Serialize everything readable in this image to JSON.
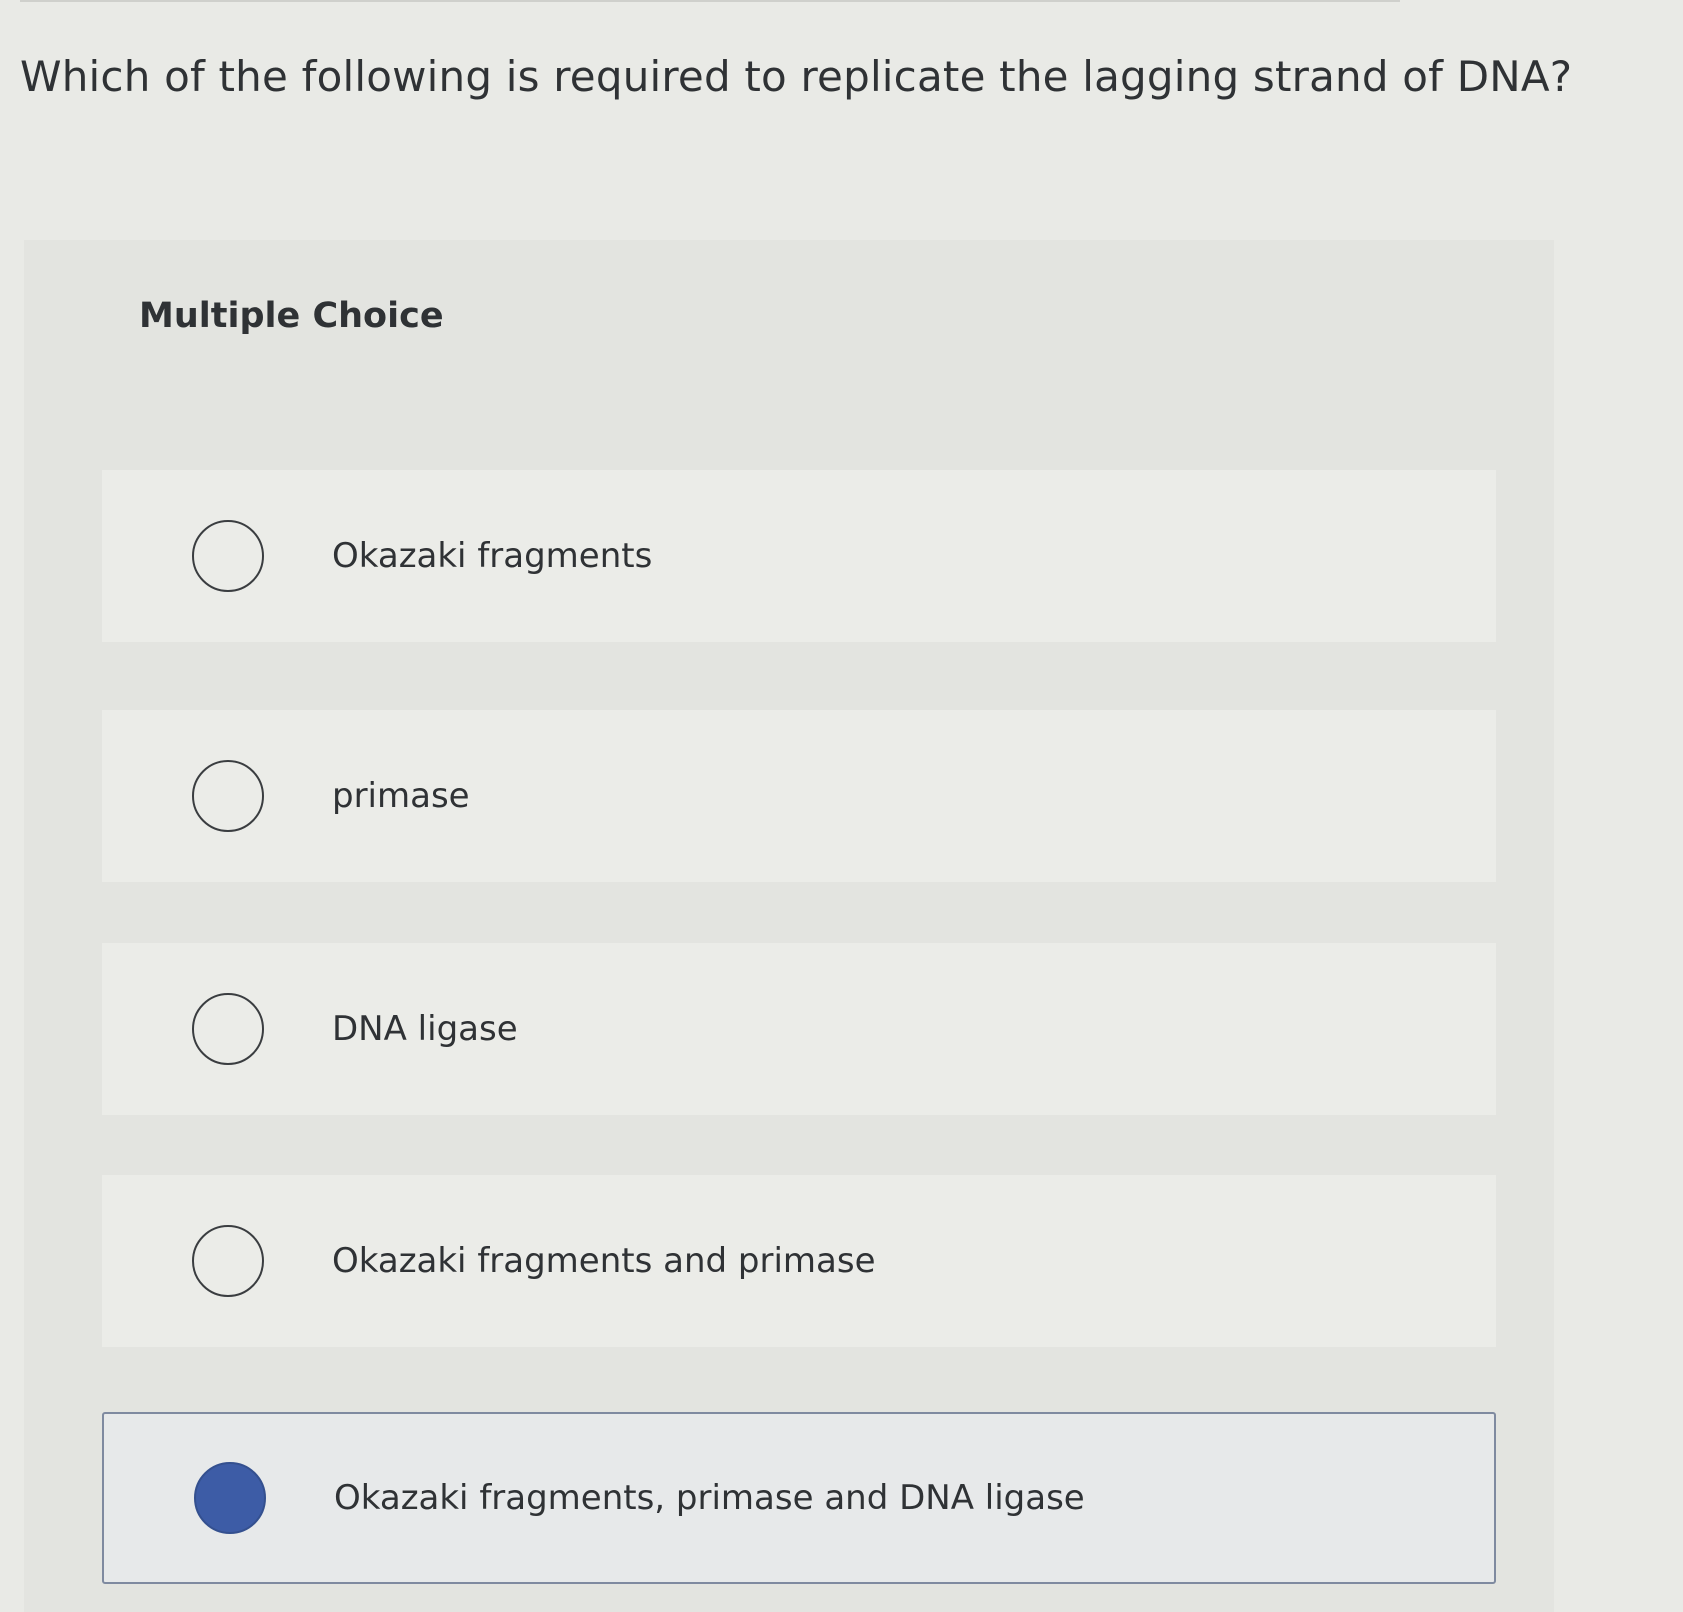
{
  "question": "Which of the following is required to replicate the lagging strand of DNA?",
  "section_label": "Multiple Choice",
  "options": [
    {
      "label": "Okazaki fragments",
      "selected": false
    },
    {
      "label": "primase",
      "selected": false
    },
    {
      "label": "DNA ligase",
      "selected": false
    },
    {
      "label": "Okazaki fragments and primase",
      "selected": false
    },
    {
      "label": "Okazaki fragments, primase and DNA ligase",
      "selected": true
    }
  ],
  "colors": {
    "selected_radio": "#3d5ca6",
    "selected_border": "#7f8aa0"
  }
}
